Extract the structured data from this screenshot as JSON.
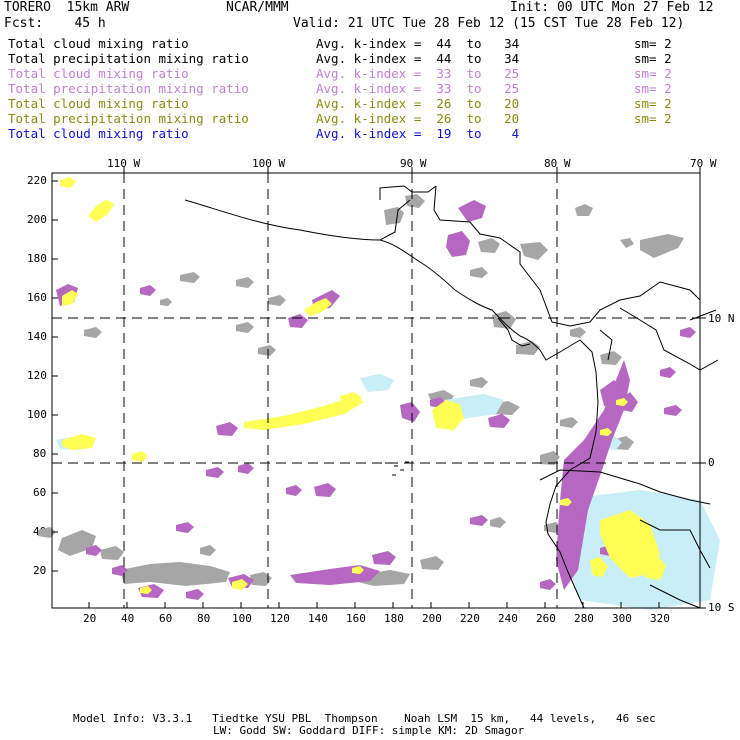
{
  "header": {
    "model": "TORERO  15km ARW",
    "org": "NCAR/MMM",
    "init": "Init: 00 UTC Mon 27 Feb 12",
    "fcst": "Fcst:    45 h",
    "valid": "Valid: 21 UTC Tue 28 Feb 12 (15 CST Tue 28 Feb 12)"
  },
  "legend": [
    {
      "field": "Total cloud mixing ratio",
      "kindex": "Avg. k-index =  44  to   34",
      "sm": "sm= 2",
      "color": "#000000"
    },
    {
      "field": "Total precipitation mixing ratio",
      "kindex": "Avg. k-index =  44  to   34",
      "sm": "sm= 2",
      "color": "#000000"
    },
    {
      "field": "Total cloud mixing ratio",
      "kindex": "Avg. k-index =  33  to   25",
      "sm": "sm= 2",
      "color": "#c27fd4"
    },
    {
      "field": "Total precipitation mixing ratio",
      "kindex": "Avg. k-index =  33  to   25",
      "sm": "sm= 2",
      "color": "#c27fd4"
    },
    {
      "field": "Total cloud mixing ratio",
      "kindex": "Avg. k-index =  26  to   20",
      "sm": "sm= 2",
      "color": "#8a8a10"
    },
    {
      "field": "Total precipitation mixing ratio",
      "kindex": "Avg. k-index =  26  to   20",
      "sm": "sm= 2",
      "color": "#8a8a10"
    },
    {
      "field": "Total cloud mixing ratio",
      "kindex": "Avg. k-index =  19  to    4",
      "sm": "",
      "color": "#1010d0"
    }
  ],
  "map": {
    "lon_labels": [
      "110 W",
      "100 W",
      "90 W",
      "80 W",
      "70 W"
    ],
    "lat_labels": [
      "10 N",
      "0",
      "10 S"
    ],
    "y_ticks": [
      "220",
      "200",
      "180",
      "160",
      "140",
      "120",
      "100",
      "80",
      "60",
      "40",
      "20"
    ],
    "x_ticks": [
      "20",
      "40",
      "60",
      "80",
      "100",
      "120",
      "140",
      "160",
      "180",
      "200",
      "220",
      "240",
      "260",
      "280",
      "300",
      "320"
    ]
  },
  "footer": {
    "line1": "Model Info: V3.3.1   Tiedtke YSU PBL  Thompson    Noah LSM  15 km,   44 levels,   46 sec",
    "line2": "LW: Godd SW: Goddard DIFF: simple KM: 2D Smagor"
  },
  "colors": {
    "gray": "#a6a6a6",
    "purple": "#b567c2",
    "yellow": "#ffff55",
    "cyan": "#c8eef8"
  }
}
